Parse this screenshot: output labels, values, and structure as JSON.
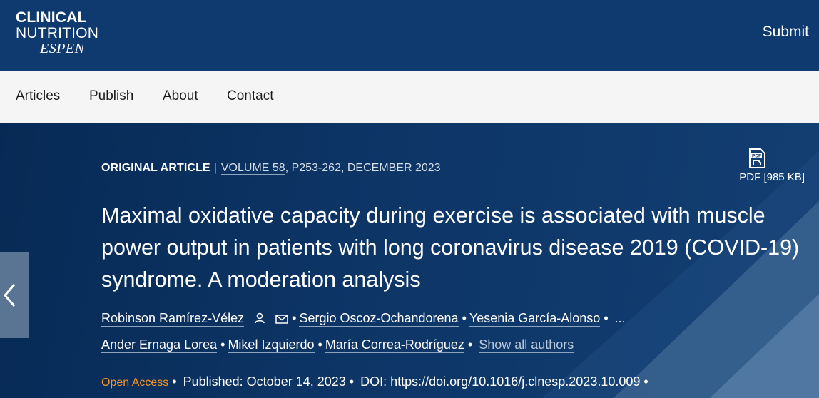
{
  "journal": {
    "logo_line1": "CLINICAL",
    "logo_line2": "NUTRITION",
    "logo_line3": "ESPEN"
  },
  "header": {
    "submit_label": "Submit"
  },
  "nav": {
    "items": [
      "Articles",
      "Publish",
      "About",
      "Contact"
    ]
  },
  "article": {
    "type": "ORIGINAL ARTICLE",
    "separator": "|",
    "volume": "VOLUME 58",
    "pages_date": ", P253-262, DECEMBER 2023",
    "pdf_label": "PDF [985 KB]",
    "pdf_icon": "pdf-icon",
    "title": "Maximal oxidative capacity during exercise is associated with muscle power output in patients with long coronavirus disease 2019 (COVID-19) syndrome. A moderation analysis",
    "authors_row1": [
      "Robinson Ramírez-Vélez",
      "Sergio Oscoz-Ochandorena",
      "Yesenia García-Alonso"
    ],
    "ellipsis": "...",
    "authors_row2": [
      "Ander Ernaga Lorea",
      "Mikel Izquierdo",
      "María Correa-Rodríguez"
    ],
    "show_all": "Show all authors",
    "open_access": "Open Access",
    "published": "Published: October 14, 2023",
    "doi_label": "DOI:",
    "doi": "https://doi.org/10.1016/j.clnesp.2023.10.009",
    "bullet": "•"
  },
  "colors": {
    "header_bg": "#0f3a70",
    "nav_bg": "#f5f5f5",
    "hero_bg": "#0d3566",
    "open_access": "#f7931e",
    "prev_button": "#5a7594"
  }
}
